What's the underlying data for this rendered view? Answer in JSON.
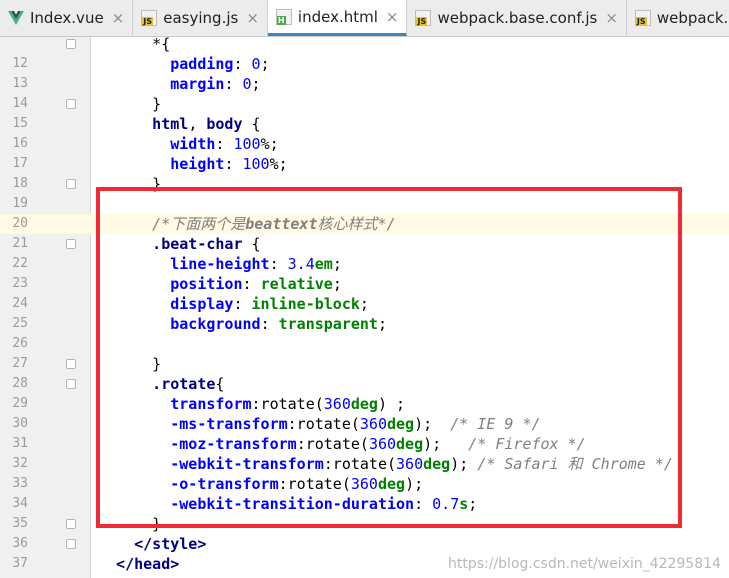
{
  "tabs": [
    {
      "label": "Index.vue",
      "icon": "vue-icon",
      "active": false,
      "close": "×"
    },
    {
      "label": "easying.js",
      "icon": "js-file-icon",
      "active": false,
      "close": "×"
    },
    {
      "label": "index.html",
      "icon": "html-file-icon",
      "active": true,
      "close": "×"
    },
    {
      "label": "webpack.base.conf.js",
      "icon": "js-file-icon",
      "active": false,
      "close": "×"
    },
    {
      "label": "webpack.dev.conf.js",
      "icon": "js-file-icon",
      "active": false,
      "close": "×"
    }
  ],
  "editor": {
    "current_line": 20,
    "lines": [
      {
        "n": "",
        "tokens": [
          [
            "plain",
            "      *{"
          ]
        ]
      },
      {
        "n": "12",
        "tokens": [
          [
            "prop",
            "        padding"
          ],
          [
            "plain",
            ": "
          ],
          [
            "num",
            "0"
          ],
          [
            "plain",
            ";"
          ]
        ]
      },
      {
        "n": "13",
        "tokens": [
          [
            "prop",
            "        margin"
          ],
          [
            "plain",
            ": "
          ],
          [
            "num",
            "0"
          ],
          [
            "plain",
            ";"
          ]
        ]
      },
      {
        "n": "14",
        "tokens": [
          [
            "plain",
            "      }"
          ]
        ]
      },
      {
        "n": "15",
        "tokens": [
          [
            "sel",
            "      html"
          ],
          [
            "plain",
            ", "
          ],
          [
            "sel",
            "body"
          ],
          [
            "plain",
            " {"
          ]
        ]
      },
      {
        "n": "16",
        "tokens": [
          [
            "prop",
            "        width"
          ],
          [
            "plain",
            ": "
          ],
          [
            "num",
            "100"
          ],
          [
            "plain",
            "%;"
          ]
        ]
      },
      {
        "n": "17",
        "tokens": [
          [
            "prop",
            "        height"
          ],
          [
            "plain",
            ": "
          ],
          [
            "num",
            "100"
          ],
          [
            "plain",
            "%;"
          ]
        ]
      },
      {
        "n": "18",
        "tokens": [
          [
            "plain",
            "      }"
          ]
        ]
      },
      {
        "n": "19",
        "tokens": []
      },
      {
        "n": "20",
        "tokens": [
          [
            "cmt",
            "      /*下面两个是"
          ],
          [
            "cmtb",
            "beattext"
          ],
          [
            "cmt",
            "核心样式*/"
          ]
        ]
      },
      {
        "n": "21",
        "tokens": [
          [
            "sel",
            "      .beat-char"
          ],
          [
            "plain",
            " {"
          ]
        ]
      },
      {
        "n": "22",
        "tokens": [
          [
            "prop",
            "        line-height"
          ],
          [
            "plain",
            ": "
          ],
          [
            "num",
            "3.4"
          ],
          [
            "unit",
            "em"
          ],
          [
            "plain",
            ";"
          ]
        ]
      },
      {
        "n": "23",
        "tokens": [
          [
            "prop",
            "        position"
          ],
          [
            "plain",
            ": "
          ],
          [
            "kw",
            "relative"
          ],
          [
            "plain",
            ";"
          ]
        ]
      },
      {
        "n": "24",
        "tokens": [
          [
            "prop",
            "        display"
          ],
          [
            "plain",
            ": "
          ],
          [
            "kw",
            "inline-block"
          ],
          [
            "plain",
            ";"
          ]
        ]
      },
      {
        "n": "25",
        "tokens": [
          [
            "prop",
            "        background"
          ],
          [
            "plain",
            ": "
          ],
          [
            "kw",
            "transparent"
          ],
          [
            "plain",
            ";"
          ]
        ]
      },
      {
        "n": "26",
        "tokens": []
      },
      {
        "n": "27",
        "tokens": [
          [
            "plain",
            "      }"
          ]
        ]
      },
      {
        "n": "28",
        "tokens": [
          [
            "sel",
            "      .rotate"
          ],
          [
            "plain",
            "{"
          ]
        ]
      },
      {
        "n": "29",
        "tokens": [
          [
            "prop",
            "        transform"
          ],
          [
            "plain",
            ":rotate("
          ],
          [
            "num",
            "360"
          ],
          [
            "unit",
            "deg"
          ],
          [
            "plain",
            ") ;"
          ]
        ]
      },
      {
        "n": "30",
        "tokens": [
          [
            "prop",
            "        -ms-transform"
          ],
          [
            "plain",
            ":rotate("
          ],
          [
            "num",
            "360"
          ],
          [
            "unit",
            "deg"
          ],
          [
            "plain",
            ");  "
          ],
          [
            "cmt",
            "/* IE 9 */"
          ]
        ]
      },
      {
        "n": "31",
        "tokens": [
          [
            "prop",
            "        -moz-transform"
          ],
          [
            "plain",
            ":rotate("
          ],
          [
            "num",
            "360"
          ],
          [
            "unit",
            "deg"
          ],
          [
            "plain",
            ");   "
          ],
          [
            "cmt",
            "/* Firefox */"
          ]
        ]
      },
      {
        "n": "32",
        "tokens": [
          [
            "prop",
            "        -webkit-transform"
          ],
          [
            "plain",
            ":rotate("
          ],
          [
            "num",
            "360"
          ],
          [
            "unit",
            "deg"
          ],
          [
            "plain",
            "); "
          ],
          [
            "cmt",
            "/* Safari 和 Chrome */"
          ]
        ]
      },
      {
        "n": "33",
        "tokens": [
          [
            "prop",
            "        -o-transform"
          ],
          [
            "plain",
            ":rotate("
          ],
          [
            "num",
            "360"
          ],
          [
            "unit",
            "deg"
          ],
          [
            "plain",
            ");"
          ]
        ]
      },
      {
        "n": "34",
        "tokens": [
          [
            "prop",
            "        -webkit-transition-duration"
          ],
          [
            "plain",
            ": "
          ],
          [
            "num",
            "0.7"
          ],
          [
            "unit",
            "s"
          ],
          [
            "plain",
            ";"
          ]
        ]
      },
      {
        "n": "35",
        "tokens": [
          [
            "plain",
            "      }"
          ]
        ]
      },
      {
        "n": "36",
        "tokens": [
          [
            "tag",
            "    </style>"
          ]
        ]
      },
      {
        "n": "37",
        "tokens": [
          [
            "tag",
            "  </head>"
          ]
        ]
      }
    ],
    "fold_markers": [
      11,
      14,
      18,
      21,
      27,
      28,
      35,
      36
    ]
  },
  "annotation": {
    "color": "#ef2b36"
  },
  "watermark": "https://blog.csdn.net/weixin_42295814"
}
